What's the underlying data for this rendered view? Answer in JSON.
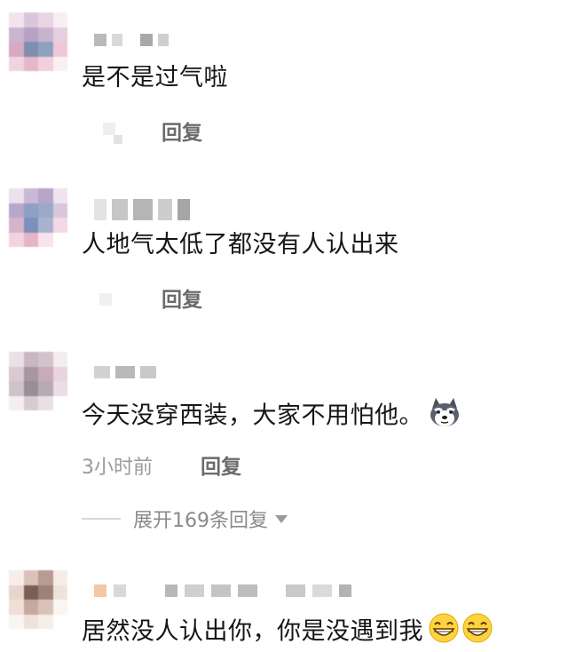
{
  "comments": [
    {
      "text": "是不是过气啦",
      "reply_label": "回复"
    },
    {
      "text": "人地气太低了都没有人认出来",
      "reply_label": "回复"
    },
    {
      "text": "今天没穿西装，大家不用怕他。",
      "emoji": "husky-doge-emoji",
      "timestamp": "3小时前",
      "reply_label": "回复",
      "expand_label": "展开169条回复"
    },
    {
      "text": "居然没人认出你，你是没遇到我",
      "emoji": "grin-emoji"
    }
  ],
  "colors": {
    "text": "#151515",
    "meta": "#9a9a9a",
    "reply": "#6b6b6b",
    "divider": "#d6d6d6"
  }
}
